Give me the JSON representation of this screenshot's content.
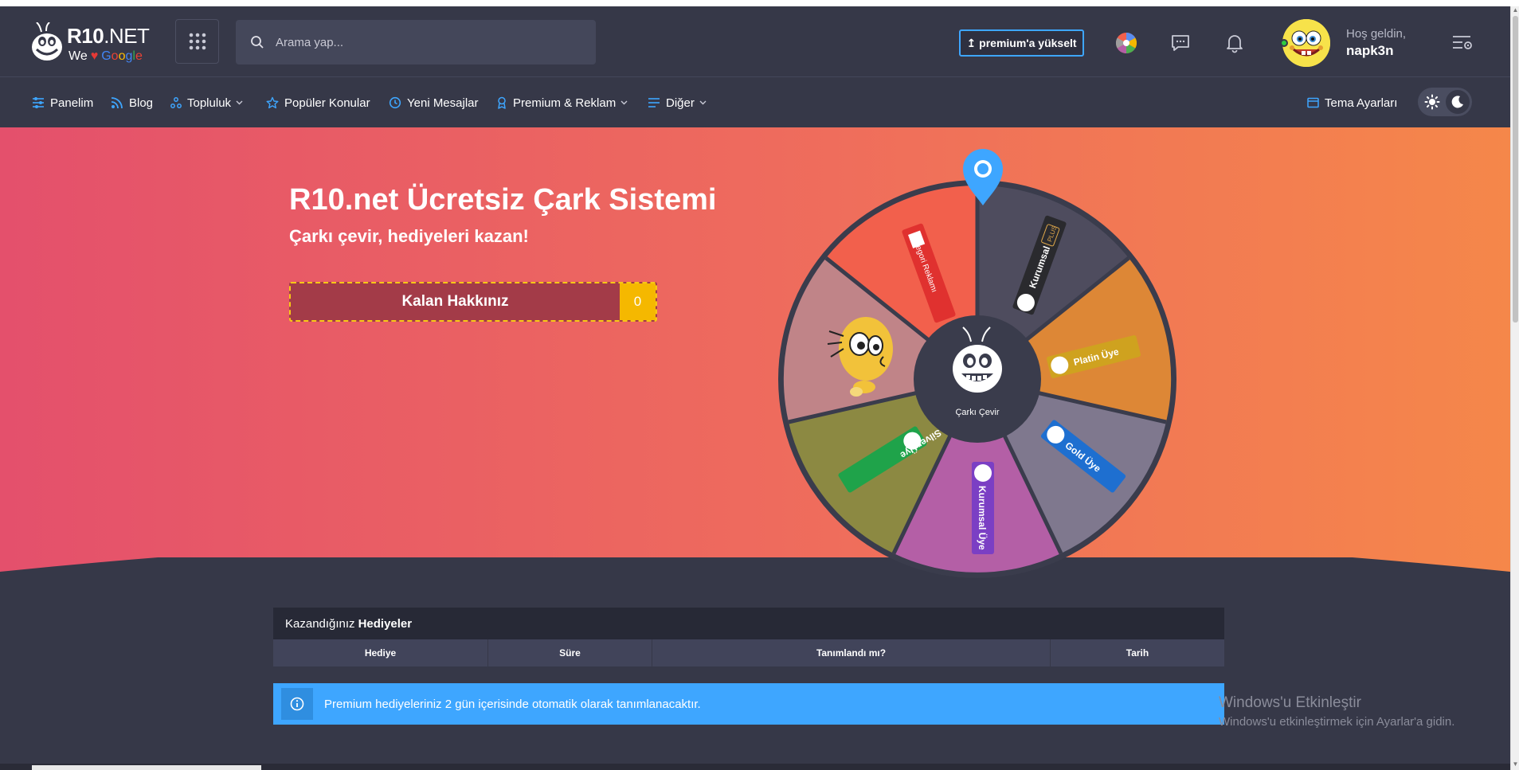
{
  "header": {
    "logo_name": "R10",
    "logo_suffix": ".NET",
    "logo_we": "We",
    "logo_brand": [
      "G",
      "o",
      "o",
      "g",
      "l",
      "e"
    ],
    "search_placeholder": "Arama yap...",
    "premium_label": "premium'a yükselt",
    "welcome": "Hoş geldin,",
    "username": "napk3n"
  },
  "nav": {
    "items": [
      {
        "label": "Panelim",
        "icon": "sliders-icon"
      },
      {
        "label": "Blog",
        "icon": "rss-icon"
      },
      {
        "label": "Topluluk",
        "icon": "community-icon",
        "dropdown": true
      },
      {
        "label": "Popüler Konular",
        "icon": "star-icon"
      },
      {
        "label": "Yeni Mesajlar",
        "icon": "clock-icon"
      },
      {
        "label": "Premium & Reklam",
        "icon": "award-icon",
        "dropdown": true
      },
      {
        "label": "Diğer",
        "icon": "list-icon",
        "dropdown": true
      }
    ],
    "theme_settings": "Tema Ayarları"
  },
  "hero": {
    "title": "R10.net Ücretsiz Çark Sistemi",
    "subtitle": "Çarkı çevir, hediyeleri kazan!",
    "remaining_label": "Kalan Hakkınız",
    "remaining_count": "0"
  },
  "wheel": {
    "center_label": "Çarkı Çevir",
    "segments": [
      {
        "label": "Kurumsal",
        "badge": "PLUS",
        "color": "#4e4c5e"
      },
      {
        "label": "Platin Üye",
        "color": "#dd8736"
      },
      {
        "label": "Gold Üye",
        "color": "#7f788e"
      },
      {
        "label": "Kurumsal Üye",
        "color": "#b45fa6"
      },
      {
        "label": "Silver Üye",
        "color": "#8c8942"
      },
      {
        "label": "",
        "color": "#c08488"
      },
      {
        "label": "Kategori Reklamı",
        "color": "#f2604c"
      }
    ],
    "pointer_color": "#3ea6ff"
  },
  "gifts": {
    "heading_normal": "Kazandığınız",
    "heading_bold": "Hediyeler",
    "columns": [
      "Hediye",
      "Süre",
      "Tanımlandı mı?",
      "Tarih"
    ]
  },
  "info": {
    "text": "Premium hediyeleriniz 2 gün içerisinde otomatik olarak tanımlanacaktır."
  },
  "windows": {
    "title": "Windows'u Etkinleştir",
    "subtitle": "Windows'u etkinleştirmek için Ayarlar'a gidin."
  },
  "colors": {
    "header_bg": "#363848",
    "accent": "#3ea6ff",
    "hero_start": "#e4506c",
    "hero_end": "#f5874a",
    "remaining_bg": "#a33b48",
    "count_bg": "#f5b800"
  }
}
